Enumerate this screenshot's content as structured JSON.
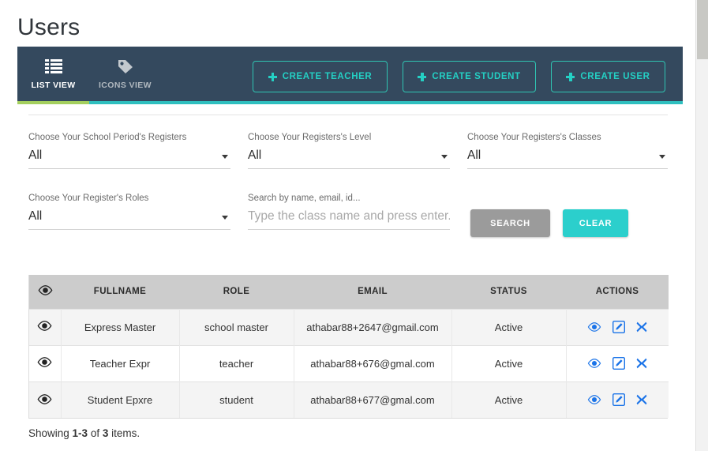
{
  "page": {
    "title": "Users"
  },
  "header": {
    "tabs": [
      {
        "label": "LIST VIEW",
        "icon": "list-icon",
        "active": true
      },
      {
        "label": "ICONS VIEW",
        "icon": "tag-icon",
        "active": false
      }
    ],
    "buttons": [
      {
        "label": "CREATE TEACHER",
        "icon": "plus-icon"
      },
      {
        "label": "CREATE STUDENT",
        "icon": "plus-icon"
      },
      {
        "label": "CREATE USER",
        "icon": "plus-icon"
      }
    ],
    "colors": {
      "bar_background": "#34495e",
      "accent_teal": "#2fbfbf",
      "active_underline_green": "#a4cf5e",
      "button_border": "#2fc4b2",
      "button_text": "#24d0c4"
    }
  },
  "filters": {
    "period": {
      "label": "Choose Your School Period's Registers",
      "value": "All"
    },
    "level": {
      "label": "Choose Your Registers's Level",
      "value": "All"
    },
    "classes": {
      "label": "Choose Your Registers's Classes",
      "value": "All"
    },
    "roles": {
      "label": "Choose Your Register's Roles",
      "value": "All"
    },
    "search": {
      "label": "Search by name, email, id...",
      "value": "",
      "placeholder": "Type the class name and press enter..."
    },
    "search_button": {
      "label": "SEARCH",
      "color": "#9b9b9b"
    },
    "clear_button": {
      "label": "CLEAR",
      "color": "#2bcfcc"
    }
  },
  "table": {
    "columns": [
      "",
      "FULLNAME",
      "ROLE",
      "EMAIL",
      "STATUS",
      "ACTIONS"
    ],
    "header_eye_icon": "eye-icon",
    "rows": [
      {
        "fullname": "Express Master",
        "role": "school master",
        "email": "athabar88+2647@gmail.com",
        "status": "Active"
      },
      {
        "fullname": "Teacher Expr",
        "role": "teacher",
        "email": "athabar88+676@gmal.com",
        "status": "Active"
      },
      {
        "fullname": "Student Epxre",
        "role": "student",
        "email": "athabar88+677@gmal.com",
        "status": "Active"
      }
    ],
    "row_actions": [
      "view-icon",
      "edit-icon",
      "delete-icon"
    ],
    "action_icon_color": "#1a73e8"
  },
  "footer": {
    "prefix": "Showing ",
    "range": "1-3",
    "middle": " of ",
    "total": "3",
    "suffix": " items."
  }
}
